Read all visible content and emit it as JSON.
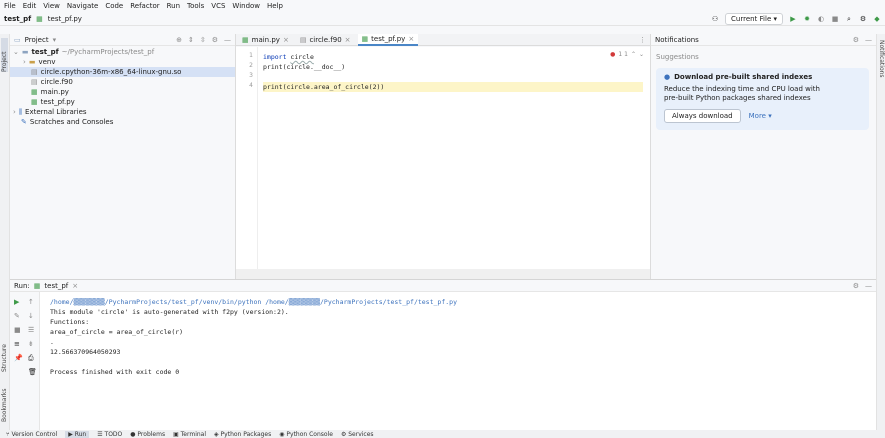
{
  "menu": [
    "File",
    "Edit",
    "View",
    "Navigate",
    "Code",
    "Refactor",
    "Run",
    "Tools",
    "VCS",
    "Window",
    "Help"
  ],
  "breadcrumb": {
    "project": "test_pf",
    "file": "test_pf.py"
  },
  "toolbar": {
    "config": "Current File"
  },
  "project": {
    "header": "Project",
    "root_name": "test_pf",
    "root_path": "~/PycharmProjects/test_pf",
    "items": [
      "venv",
      "circle.cpython-36m-x86_64-linux-gnu.so",
      "circle.f90",
      "main.py",
      "test_pf.py",
      "External Libraries",
      "Scratches and Consoles"
    ]
  },
  "tabs": [
    "main.py",
    "circle.f90",
    "test_pf.py"
  ],
  "editor": {
    "line_numbers": [
      "1",
      "2",
      "3",
      "4"
    ],
    "line1_kw": "import",
    "line1_mod": "circle",
    "line2": "print(circle.__doc__)",
    "line4": "print(circle.area_of_circle(2))",
    "inspection": "1  1"
  },
  "strip": {
    "project": "Project",
    "structure": "Structure",
    "bookmarks": "Bookmarks",
    "notifications": "Notifications"
  },
  "notifications": {
    "title": "Notifications",
    "suggestions": "Suggestions",
    "card_title": "Download pre-built shared indexes",
    "card_body_1": "Reduce the indexing time and CPU load with",
    "card_body_2": "pre-built Python packages shared indexes",
    "always_download": "Always download",
    "more": "More"
  },
  "run": {
    "label": "Run:",
    "tab": "test_pf",
    "lines": [
      "/home/▒▒▒▒▒▒▒▒/PycharmProjects/test_pf/venv/bin/python /home/▒▒▒▒▒▒▒▒/PycharmProjects/test_pf/test_pf.py",
      "This module 'circle' is auto-generated with f2py (version:2).",
      "Functions:",
      "  area_of_circle = area_of_circle(r)",
      ".",
      "12.566370964050293",
      "",
      "Process finished with exit code 0"
    ]
  },
  "bottom": [
    "Version Control",
    "Run",
    "TODO",
    "Problems",
    "Terminal",
    "Python Packages",
    "Python Console",
    "Services"
  ]
}
